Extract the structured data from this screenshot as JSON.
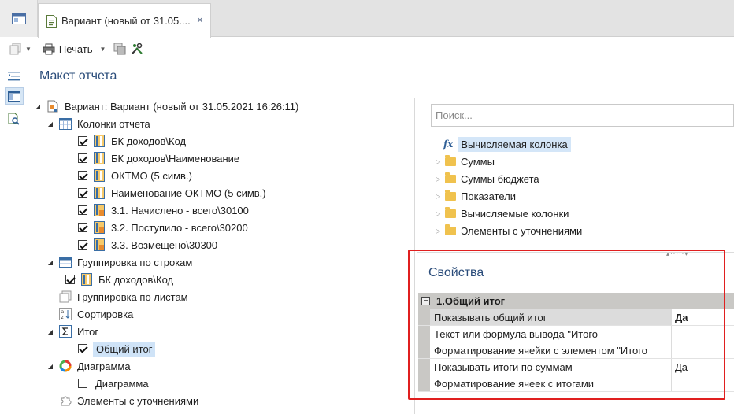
{
  "tabs": {
    "document_tab_title": "Вариант (новый от 31.05....",
    "close_glyph": "×"
  },
  "toolbar": {
    "print_label": "Печать"
  },
  "layout_section": {
    "title": "Макет отчета"
  },
  "tree": {
    "root": "Вариант: Вариант (новый от 31.05.2021 16:26:11)",
    "columns_group": "Колонки отчета",
    "columns": [
      {
        "label": "БК доходов\\Код",
        "checked": true,
        "icon": "column-icon"
      },
      {
        "label": "БК доходов\\Наименование",
        "checked": true,
        "icon": "column-icon"
      },
      {
        "label": "ОКТМО (5 симв.)",
        "checked": true,
        "icon": "column-icon"
      },
      {
        "label": "Наименование ОКТМО (5 симв.)",
        "checked": true,
        "icon": "column-icon"
      },
      {
        "label": "3.1. Начислено - всего\\30100",
        "checked": true,
        "icon": "sum-column-icon"
      },
      {
        "label": "3.2. Поступило - всего\\30200",
        "checked": true,
        "icon": "sum-column-icon"
      },
      {
        "label": "3.3. Возмещено\\30300",
        "checked": true,
        "icon": "sum-column-icon"
      }
    ],
    "row_grouping": "Группировка по строкам",
    "row_grouping_items": [
      {
        "label": "БК доходов\\Код",
        "checked": true
      }
    ],
    "sheet_grouping": "Группировка по листам",
    "sorting": "Сортировка",
    "total": "Итог",
    "total_items": [
      {
        "label": "Общий итог",
        "checked": true,
        "selected": true
      }
    ],
    "chart": "Диаграмма",
    "chart_items": [
      {
        "label": "Диаграмма",
        "checked": false
      }
    ],
    "refinements": "Элементы с уточнениями"
  },
  "fields_panel": {
    "search_placeholder": "Поиск...",
    "items": [
      {
        "label": "Вычисляемая колонка",
        "type": "function",
        "selected": true
      },
      {
        "label": "Суммы",
        "type": "folder"
      },
      {
        "label": "Суммы бюджета",
        "type": "folder"
      },
      {
        "label": "Показатели",
        "type": "folder"
      },
      {
        "label": "Вычисляемые колонки",
        "type": "folder"
      },
      {
        "label": "Элементы с уточнениями",
        "type": "folder"
      }
    ]
  },
  "properties": {
    "title": "Свойства",
    "category": "1.Общий итог",
    "rows": [
      {
        "name": "Показывать общий итог",
        "value": "Да",
        "selected": true,
        "bold_value": true
      },
      {
        "name": "Текст или формула вывода \"Итого",
        "value": ""
      },
      {
        "name": "Форматирование ячейки с элементом \"Итого",
        "value": ""
      },
      {
        "name": "Показывать итоги по суммам",
        "value": "Да"
      },
      {
        "name": "Форматирование ячеек с итогами",
        "value": ""
      }
    ]
  },
  "colors": {
    "accent_title": "#2a4c7a",
    "highlight_box": "#e01f1f",
    "selection": "#cfe3f7"
  }
}
